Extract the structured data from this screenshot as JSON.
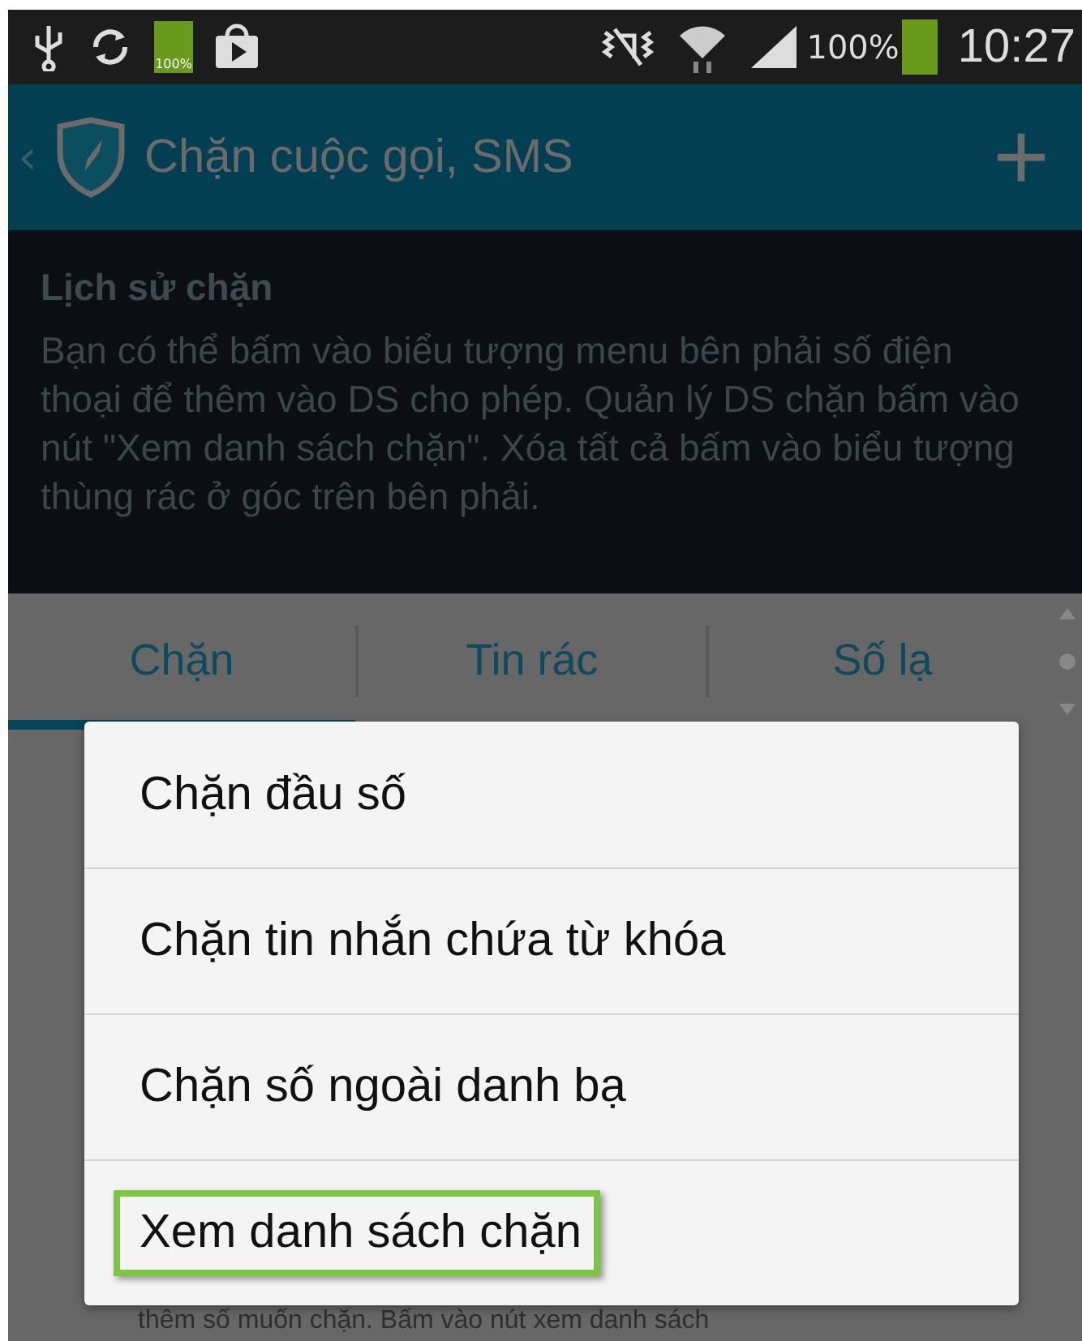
{
  "status_bar": {
    "battery_icon_label": "100%",
    "battery_percent": "100%",
    "time": "10:27"
  },
  "app_bar": {
    "back": "‹",
    "title": "Chặn cuộc gọi, SMS",
    "add": "+"
  },
  "info": {
    "title": "Lịch sử chặn",
    "text": "Bạn có thể bấm vào biểu tượng menu bên phải số điện thoại để thêm vào DS cho phép. Quản lý DS chặn bấm vào nút \"Xem danh sách chặn\". Xóa tất cả bấm vào biểu tượng thùng rác ở góc trên bên phải."
  },
  "tabs": [
    {
      "label": "Chặn",
      "selected": true
    },
    {
      "label": "Tin rác",
      "selected": false
    },
    {
      "label": "Số lạ",
      "selected": false
    }
  ],
  "background_text": "thêm số muốn chặn. Bấm vào nút xem danh sách",
  "menu": [
    {
      "label": "Chặn đầu số",
      "highlighted": false
    },
    {
      "label": "Chặn tin nhắn chứa từ khóa",
      "highlighted": false
    },
    {
      "label": "Chặn số ngoài danh bạ",
      "highlighted": false
    },
    {
      "label": "Xem danh sách chặn",
      "highlighted": true
    }
  ]
}
